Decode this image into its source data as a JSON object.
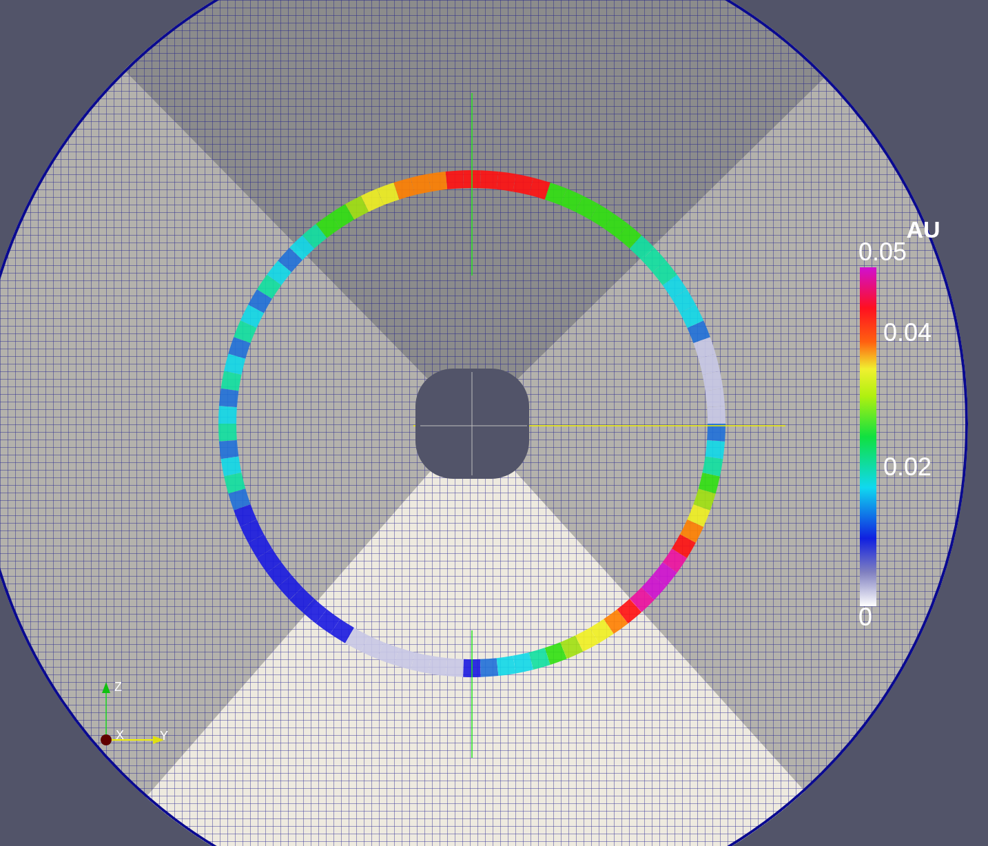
{
  "color_legend": {
    "title": "AU",
    "labels": [
      "0.05",
      "0.04",
      "0.02",
      "0"
    ]
  },
  "orientation_axes": {
    "labels": [
      "Z",
      "X",
      "Y"
    ]
  }
}
